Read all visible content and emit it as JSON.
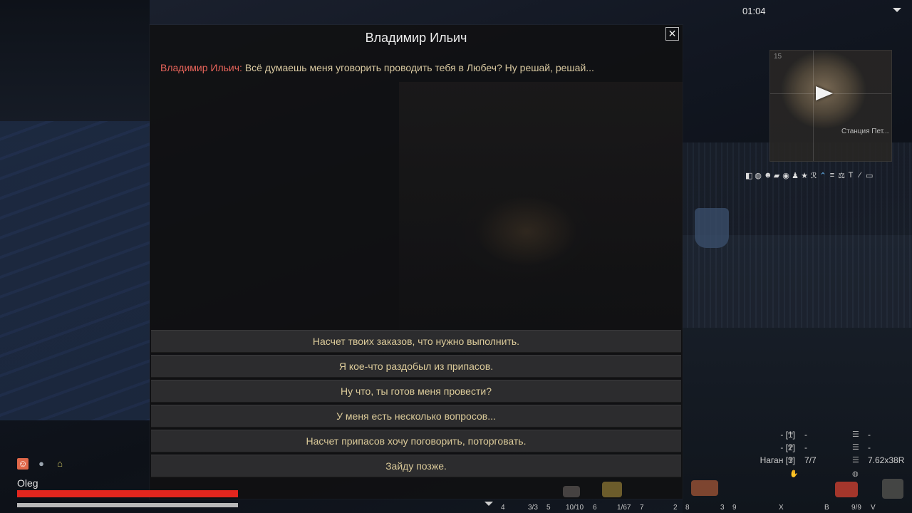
{
  "hud": {
    "clock": "01:04",
    "player_name": "Oleg",
    "health": 1.0,
    "stamina": 1.0
  },
  "minimap": {
    "coord_label": "15",
    "location_label": "Станция Пет...",
    "icons": [
      "map-book-icon",
      "globe-icon",
      "people-icon",
      "chat-icon",
      "target-icon",
      "person-icon",
      "star-icon",
      "rp-icon",
      "chevron-up-icon",
      "stairs-icon",
      "scales-icon",
      "t-icon",
      "pen-icon",
      "monitor-icon"
    ],
    "icons_accent": "#6cc0ff"
  },
  "dialog": {
    "title": "Владимир Ильич",
    "speaker": "Владимир Ильич:",
    "line": "Всё думаешь меня уговорить проводить тебя в Любеч? Ну решай, решай...",
    "options": [
      "Насчет твоих заказов, что нужно выполнить.",
      "Я кое-что раздобыл из припасов.",
      "Ну что, ты готов меня провести?",
      "У меня есть несколько вопросов...",
      "Насчет припасов хочу поговорить, поторговать.",
      "Зайду позже."
    ]
  },
  "weapons": [
    {
      "label": "- [1]",
      "ammo": "-",
      "mag": "-"
    },
    {
      "label": "- [2]",
      "ammo": "-",
      "mag": "-"
    },
    {
      "label": "Наган [3]",
      "ammo": "7/7",
      "caliber": "7.62x38R"
    }
  ],
  "hotbar": [
    {
      "key": "4"
    },
    {
      "key": "3/3",
      "slot": "5"
    },
    {
      "key": "10/10",
      "slot": "6"
    },
    {
      "key": "1/67",
      "slot": "7"
    },
    {
      "key": "2",
      "slot": "8"
    },
    {
      "key": "3",
      "slot": "9"
    },
    {
      "key": "X"
    },
    {
      "key": "B"
    },
    {
      "key": "9/9",
      "slot": "V"
    }
  ],
  "colors": {
    "npc_name": "#e8645a",
    "option_text": "#dccb9a",
    "health": "#e3261e"
  }
}
